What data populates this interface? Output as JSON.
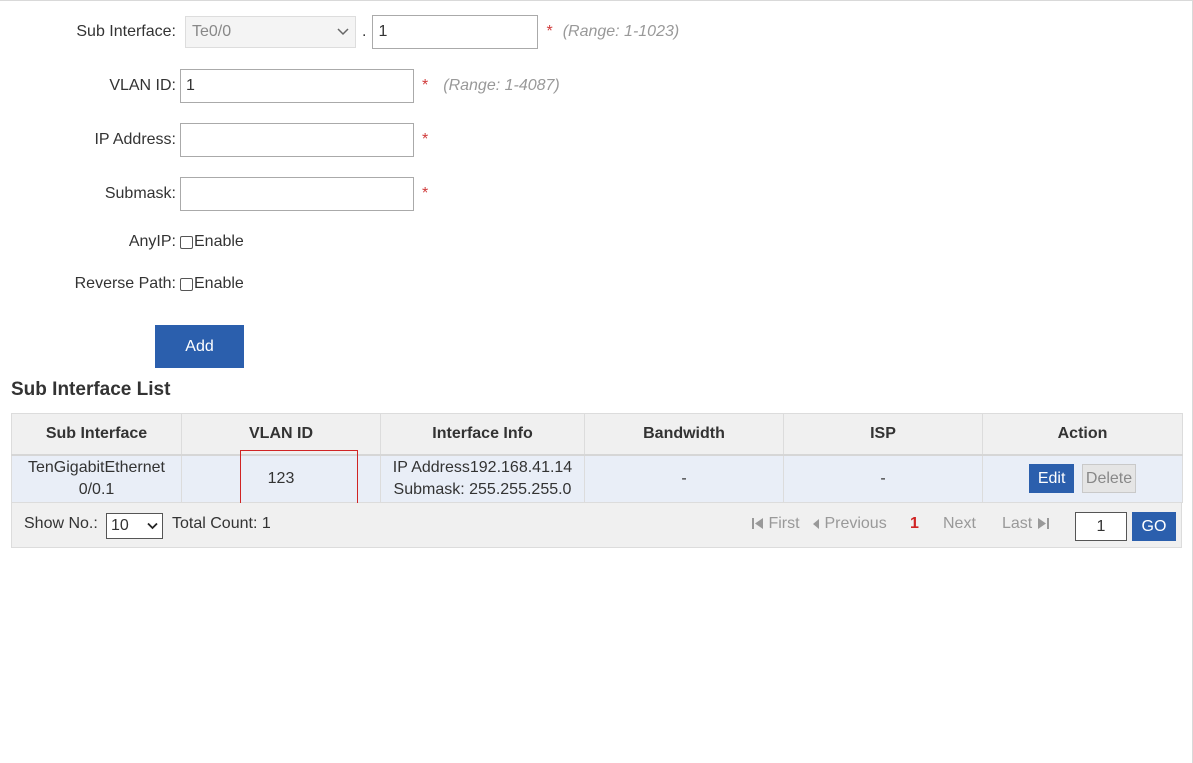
{
  "form": {
    "sub_interface": {
      "label": "Sub Interface:",
      "selected": "Te0/0",
      "separator": ".",
      "value": "1",
      "required": "*",
      "range": "(Range: 1-1023)"
    },
    "vlan_id": {
      "label": "VLAN ID:",
      "value": "1",
      "required": "*",
      "range": "(Range: 1-4087)"
    },
    "ip_address": {
      "label": "IP Address:",
      "value": "",
      "required": "*"
    },
    "submask": {
      "label": "Submask:",
      "value": "",
      "required": "*"
    },
    "anyip": {
      "label": "AnyIP:",
      "checkbox_label": "Enable"
    },
    "reverse_path": {
      "label": "Reverse Path:",
      "checkbox_label": "Enable"
    },
    "add_label": "Add"
  },
  "list": {
    "title": "Sub Interface List",
    "headers": [
      "Sub Interface",
      "VLAN ID",
      "Interface Info",
      "Bandwidth",
      "ISP",
      "Action"
    ],
    "rows": [
      {
        "sub_interface_line1": "TenGigabitEthernet",
        "sub_interface_line2": "0/0.1",
        "vlan_id": "123",
        "info_line1": "IP Address192.168.41.14",
        "info_line2": "Submask: 255.255.255.0",
        "bandwidth": "-",
        "isp": "-",
        "edit_label": "Edit",
        "delete_label": "Delete"
      }
    ]
  },
  "pager": {
    "show_label": "Show No.:",
    "page_size": "10",
    "total_label": "Total Count: 1",
    "first": "First",
    "previous": "Previous",
    "current": "1",
    "next": "Next",
    "last": "Last",
    "goto_value": "1",
    "go_label": "GO"
  },
  "colors": {
    "primary": "#2b5fad",
    "required": "#d03a3a",
    "highlight": "#d02424",
    "row_bg": "#e9eef7"
  }
}
